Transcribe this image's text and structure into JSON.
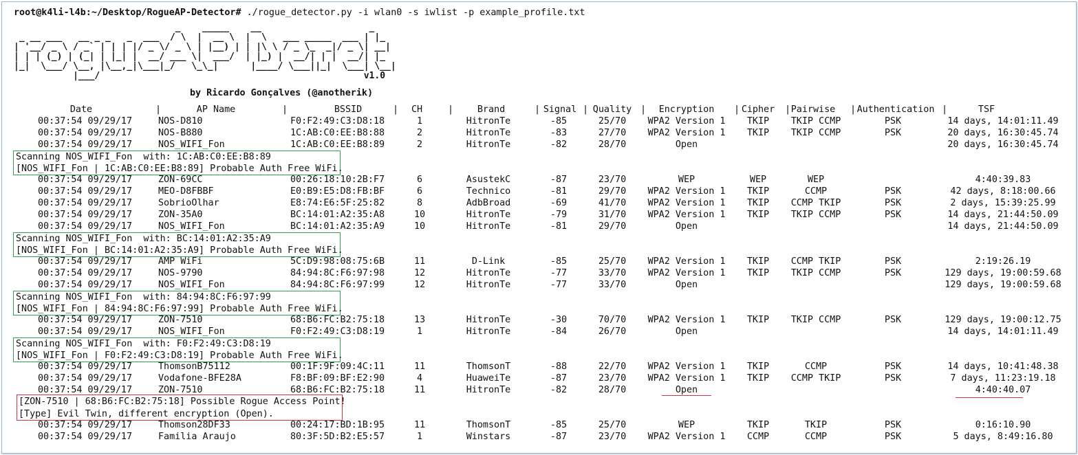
{
  "prompt": {
    "user_host": "root@k4li-l4b:",
    "path": "~/Desktop/RogueAP-Detector#",
    "command": " ./rogue_detector.py -i wlan0 -s iwlist -p example_profile.txt"
  },
  "banner": {
    "art": "                              _    _____    __                    _ \n _ __ ___   __ _ _   _  ___  / \\  |  __ \\  |  \\   ___ _____  ___ | |_\n| '__/ _ \\ / _` | | | |/ _ \\/ _ \\ | |__) | | |\\ \\ / _ \\_  _|/ _ \\| __|\n| | | (_) | (_| | |_| |  __/ ___ \\|  ___/  | |_) |  __/| | |  __/| |_\n|_|  \\___/ \\__, |\\__,_|\\___|_/   \\_\\_|      |____/ \\___||_|  \\___| \\__|\n           |___/                                                 v1.0",
    "version": "v1.0",
    "byline": "by Ricardo Gonçalves (@anotherik)"
  },
  "columns": [
    "Date",
    "AP Name",
    "BSSID",
    "CH",
    "Brand",
    "Signal",
    "Quality",
    "Encryption",
    "Cipher",
    "Pairwise",
    "Authentication",
    "TSF"
  ],
  "rows": [
    {
      "date": "00:37:54 09/29/17",
      "ap": "NOS-D810",
      "bssid": "F0:F2:49:C3:D8:18",
      "ch": "1",
      "brand": "HitronTe",
      "signal": "-85",
      "quality": "25/70",
      "enc": "WPA2 Version 1",
      "cipher": "TKIP",
      "pairwise": "TKIP CCMP",
      "auth": "PSK",
      "tsf": "14 days, 14:01:11.49"
    },
    {
      "date": "00:37:54 09/29/17",
      "ap": "NOS-B880",
      "bssid": "1C:AB:C0:EE:B8:88",
      "ch": "2",
      "brand": "HitronTe",
      "signal": "-83",
      "quality": "27/70",
      "enc": "WPA2 Version 1",
      "cipher": "TKIP",
      "pairwise": "TKIP CCMP",
      "auth": "PSK",
      "tsf": "20 days, 16:30:45.74"
    },
    {
      "date": "00:37:54 09/29/17",
      "ap": "NOS_WIFI_Fon",
      "bssid": "1C:AB:C0:EE:B8:89",
      "ch": "2",
      "brand": "HitronTe",
      "signal": "-82",
      "quality": "28/70",
      "enc": "Open",
      "cipher": "",
      "pairwise": "",
      "auth": "",
      "tsf": "20 days, 16:30:45.74"
    },
    {
      "date": "00:37:54 09/29/17",
      "ap": "ZON-69CC",
      "bssid": "00:26:18:10:2B:F7",
      "ch": "6",
      "brand": "AsustekC",
      "signal": "-87",
      "quality": "23/70",
      "enc": "WEP",
      "cipher": "WEP",
      "pairwise": "WEP",
      "auth": "",
      "tsf": "4:40:39.83"
    },
    {
      "date": "00:37:54 09/29/17",
      "ap": "MEO-D8FBBF",
      "bssid": "E0:B9:E5:D8:FB:BF",
      "ch": "6",
      "brand": "Technico",
      "signal": "-81",
      "quality": "29/70",
      "enc": "WPA2 Version 1",
      "cipher": "TKIP",
      "pairwise": "CCMP",
      "auth": "PSK",
      "tsf": "42 days, 8:18:00.66"
    },
    {
      "date": "00:37:54 09/29/17",
      "ap": "SobrioOlhar",
      "bssid": "E8:74:E6:5F:25:82",
      "ch": "8",
      "brand": "AdbBroad",
      "signal": "-69",
      "quality": "41/70",
      "enc": "WPA2 Version 1",
      "cipher": "TKIP",
      "pairwise": "CCMP TKIP",
      "auth": "PSK",
      "tsf": "2 days, 15:39:25.99"
    },
    {
      "date": "00:37:54 09/29/17",
      "ap": "ZON-35A0",
      "bssid": "BC:14:01:A2:35:A8",
      "ch": "10",
      "brand": "HitronTe",
      "signal": "-79",
      "quality": "31/70",
      "enc": "WPA2 Version 1",
      "cipher": "TKIP",
      "pairwise": "TKIP CCMP",
      "auth": "PSK",
      "tsf": "14 days, 21:44:50.09"
    },
    {
      "date": "00:37:54 09/29/17",
      "ap": "NOS_WIFI_Fon",
      "bssid": "BC:14:01:A2:35:A9",
      "ch": "10",
      "brand": "HitronTe",
      "signal": "-81",
      "quality": "29/70",
      "enc": "Open",
      "cipher": "",
      "pairwise": "",
      "auth": "",
      "tsf": "14 days, 21:44:50.09"
    },
    {
      "date": "00:37:54 09/29/17",
      "ap": "AMP WiFi",
      "bssid": "5C:D9:98:08:75:6B",
      "ch": "11",
      "brand": "D-Link",
      "signal": "-85",
      "quality": "25/70",
      "enc": "WPA2 Version 1",
      "cipher": "TKIP",
      "pairwise": "CCMP TKIP",
      "auth": "PSK",
      "tsf": "2:19:26.19"
    },
    {
      "date": "00:37:54 09/29/17",
      "ap": "NOS-9790",
      "bssid": "84:94:8C:F6:97:98",
      "ch": "12",
      "brand": "HitronTe",
      "signal": "-77",
      "quality": "33/70",
      "enc": "WPA2 Version 1",
      "cipher": "TKIP",
      "pairwise": "TKIP CCMP",
      "auth": "PSK",
      "tsf": "129 days, 19:00:59.68"
    },
    {
      "date": "00:37:54 09/29/17",
      "ap": "NOS_WIFI_Fon",
      "bssid": "84:94:8C:F6:97:99",
      "ch": "12",
      "brand": "HitronTe",
      "signal": "-77",
      "quality": "33/70",
      "enc": "Open",
      "cipher": "",
      "pairwise": "",
      "auth": "",
      "tsf": "129 days, 19:00:59.68"
    },
    {
      "date": "00:37:54 09/29/17",
      "ap": "ZON-7510",
      "bssid": "68:B6:FC:B2:75:18",
      "ch": "13",
      "brand": "HitronTe",
      "signal": "-30",
      "quality": "70/70",
      "enc": "WPA2 Version 1",
      "cipher": "TKIP",
      "pairwise": "TKIP CCMP",
      "auth": "PSK",
      "tsf": "129 days, 19:00:12.75"
    },
    {
      "date": "00:37:54 09/29/17",
      "ap": "NOS_WIFI_Fon",
      "bssid": "F0:F2:49:C3:D8:19",
      "ch": "1",
      "brand": "HitronTe",
      "signal": "-84",
      "quality": "26/70",
      "enc": "Open",
      "cipher": "",
      "pairwise": "",
      "auth": "",
      "tsf": "14 days, 14:01:11.49"
    },
    {
      "date": "00:37:54 09/29/17",
      "ap": "ThomsonB75112",
      "bssid": "00:1F:9F:09:4C:11",
      "ch": "11",
      "brand": "ThomsonT",
      "signal": "-88",
      "quality": "22/70",
      "enc": "WPA2 Version 1",
      "cipher": "TKIP",
      "pairwise": "CCMP",
      "auth": "PSK",
      "tsf": "14 days, 10:41:48.38"
    },
    {
      "date": "00:37:54 09/29/17",
      "ap": "Vodafone-BFE28A",
      "bssid": "F8:BF:09:BF:E2:90",
      "ch": "4",
      "brand": "HuaweiTe",
      "signal": "-87",
      "quality": "23/70",
      "enc": "WPA2 Version 1",
      "cipher": "TKIP",
      "pairwise": "CCMP TKIP",
      "auth": "PSK",
      "tsf": "7 days, 11:23:19.18"
    },
    {
      "date": "00:37:54 09/29/17",
      "ap": "ZON-7510",
      "bssid": "68:B6:FC:B2:75:18",
      "ch": "11",
      "brand": "HitronTe",
      "signal": "-82",
      "quality": "28/70",
      "enc": "Open",
      "cipher": "",
      "pairwise": "",
      "auth": "",
      "tsf": "4:40:40.07"
    },
    {
      "date": "00:37:54 09/29/17",
      "ap": "Thomson28DF33",
      "bssid": "00:24:17:BD:1B:95",
      "ch": "11",
      "brand": "ThomsonT",
      "signal": "-85",
      "quality": "25/70",
      "enc": "WEP",
      "cipher": "TKIP",
      "pairwise": "TKIP",
      "auth": "PSK",
      "tsf": "0:16:10.90"
    },
    {
      "date": "00:37:54 09/29/17",
      "ap": "Familia Araujo",
      "bssid": "80:3F:5D:B2:E5:57",
      "ch": "1",
      "brand": "Winstars",
      "signal": "-87",
      "quality": "23/70",
      "enc": "WPA2 Version 1",
      "cipher": "CCMP",
      "pairwise": "CCMP",
      "auth": "PSK",
      "tsf": "5 days, 8:49:16.80"
    }
  ],
  "scans": [
    {
      "line1": "Scanning NOS_WIFI_Fon  with: 1C:AB:C0:EE:B8:89",
      "line2": "[NOS_WIFI_Fon | 1C:AB:C0:EE:B8:89] Probable Auth Free WiFi."
    },
    {
      "line1": "Scanning NOS_WIFI_Fon  with: BC:14:01:A2:35:A9",
      "line2": "[NOS_WIFI_Fon | BC:14:01:A2:35:A9] Probable Auth Free WiFi."
    },
    {
      "line1": "Scanning NOS_WIFI_Fon  with: 84:94:8C:F6:97:99",
      "line2": "[NOS_WIFI_Fon | 84:94:8C:F6:97:99] Probable Auth Free WiFi."
    },
    {
      "line1": "Scanning NOS_WIFI_Fon  with: F0:F2:49:C3:D8:19",
      "line2": "[NOS_WIFI_Fon | F0:F2:49:C3:D8:19] Probable Auth Free WiFi."
    }
  ],
  "alert": {
    "line1": "[ZON-7510 | 68:B6:FC:B2:75:18] Possible Rogue Access Point!",
    "line2": "[Type] Evil Twin, different encryption (Open)."
  },
  "colors": {
    "scan_box": "#2fa055",
    "alert_box": "#d0344a",
    "text": "#111111",
    "background": "#ffffff"
  }
}
